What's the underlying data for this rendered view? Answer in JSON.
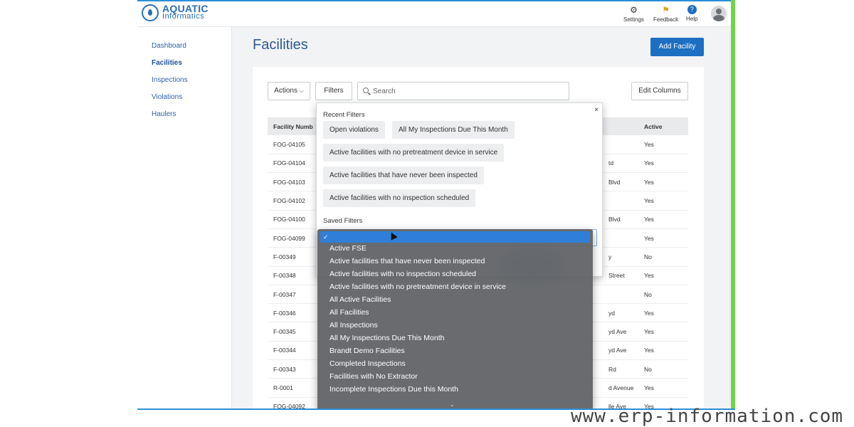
{
  "brand": {
    "line1": "AQUATIC",
    "line2": "Informatics"
  },
  "header": {
    "settings": {
      "label": "Settings",
      "icon": "gear-icon"
    },
    "feedback": {
      "label": "Feedback",
      "icon": "flag-icon"
    },
    "help": {
      "label": "Help",
      "icon": "help-icon"
    }
  },
  "sidebar": {
    "items": [
      {
        "label": "Dashboard",
        "active": false
      },
      {
        "label": "Facilities",
        "active": true
      },
      {
        "label": "Inspections",
        "active": false
      },
      {
        "label": "Violations",
        "active": false
      },
      {
        "label": "Haulers",
        "active": false
      }
    ]
  },
  "page": {
    "title": "Facilities",
    "add_button": "Add Facility"
  },
  "toolbar": {
    "actions": "Actions",
    "filters": "Filters",
    "search_placeholder": "Search",
    "edit_columns": "Edit Columns"
  },
  "table": {
    "headers": [
      "Facility Numb",
      "",
      "",
      "Active"
    ],
    "rows": [
      [
        "FOG-04105",
        "",
        "",
        "Yes"
      ],
      [
        "FOG-04104",
        "",
        "td",
        "Yes"
      ],
      [
        "FOG-04103",
        "",
        "Blvd",
        "Yes"
      ],
      [
        "FOG-04102",
        "",
        "",
        "Yes"
      ],
      [
        "FOG-04100",
        "",
        "Blvd",
        "Yes"
      ],
      [
        "FOG-04099",
        "",
        "",
        "Yes"
      ],
      [
        "F-00349",
        "",
        "y",
        "No"
      ],
      [
        "F-00348",
        "",
        "Street",
        "Yes"
      ],
      [
        "F-00347",
        "",
        "",
        "No"
      ],
      [
        "F-00346",
        "",
        "yd",
        "Yes"
      ],
      [
        "F-00345",
        "",
        "yd Ave",
        "Yes"
      ],
      [
        "F-00344",
        "",
        "yd Ave",
        "Yes"
      ],
      [
        "F-00343",
        "",
        "Rd",
        "No"
      ],
      [
        "R-0001",
        "",
        "d Avenue",
        "Yes"
      ],
      [
        "FOG-04092",
        "",
        "lle Ave",
        "Yes"
      ]
    ]
  },
  "filters_popover": {
    "close": "×",
    "recent_label": "Recent Filters",
    "recent": [
      "Open violations",
      "All My Inspections Due This Month",
      "Active facilities with no pretreatment device in service",
      "Active facilities that have never been inspected",
      "Active facilities with no inspection scheduled"
    ],
    "saved_label": "Saved Filters"
  },
  "saved_dropdown": {
    "selected": "✓",
    "options": [
      "Active FSE",
      "Active facilities that have never been inspected",
      "Active facilities with no inspection scheduled",
      "Active facilities with no pretreatment device in service",
      "All Active Facilities",
      "All Facilities",
      "All Inspections",
      "All My Inspections Due This Month",
      "Brandt Demo Facilities",
      "Completed Inspections",
      "Facilities with No Extractor",
      "Incomplete Inspections Due this Month"
    ],
    "more": "⌄"
  },
  "watermark": "www.erp-information.com",
  "colors": {
    "accent": "#1d6fc2",
    "link": "#2f5fa8",
    "side_stripe": "#6fd64a"
  }
}
